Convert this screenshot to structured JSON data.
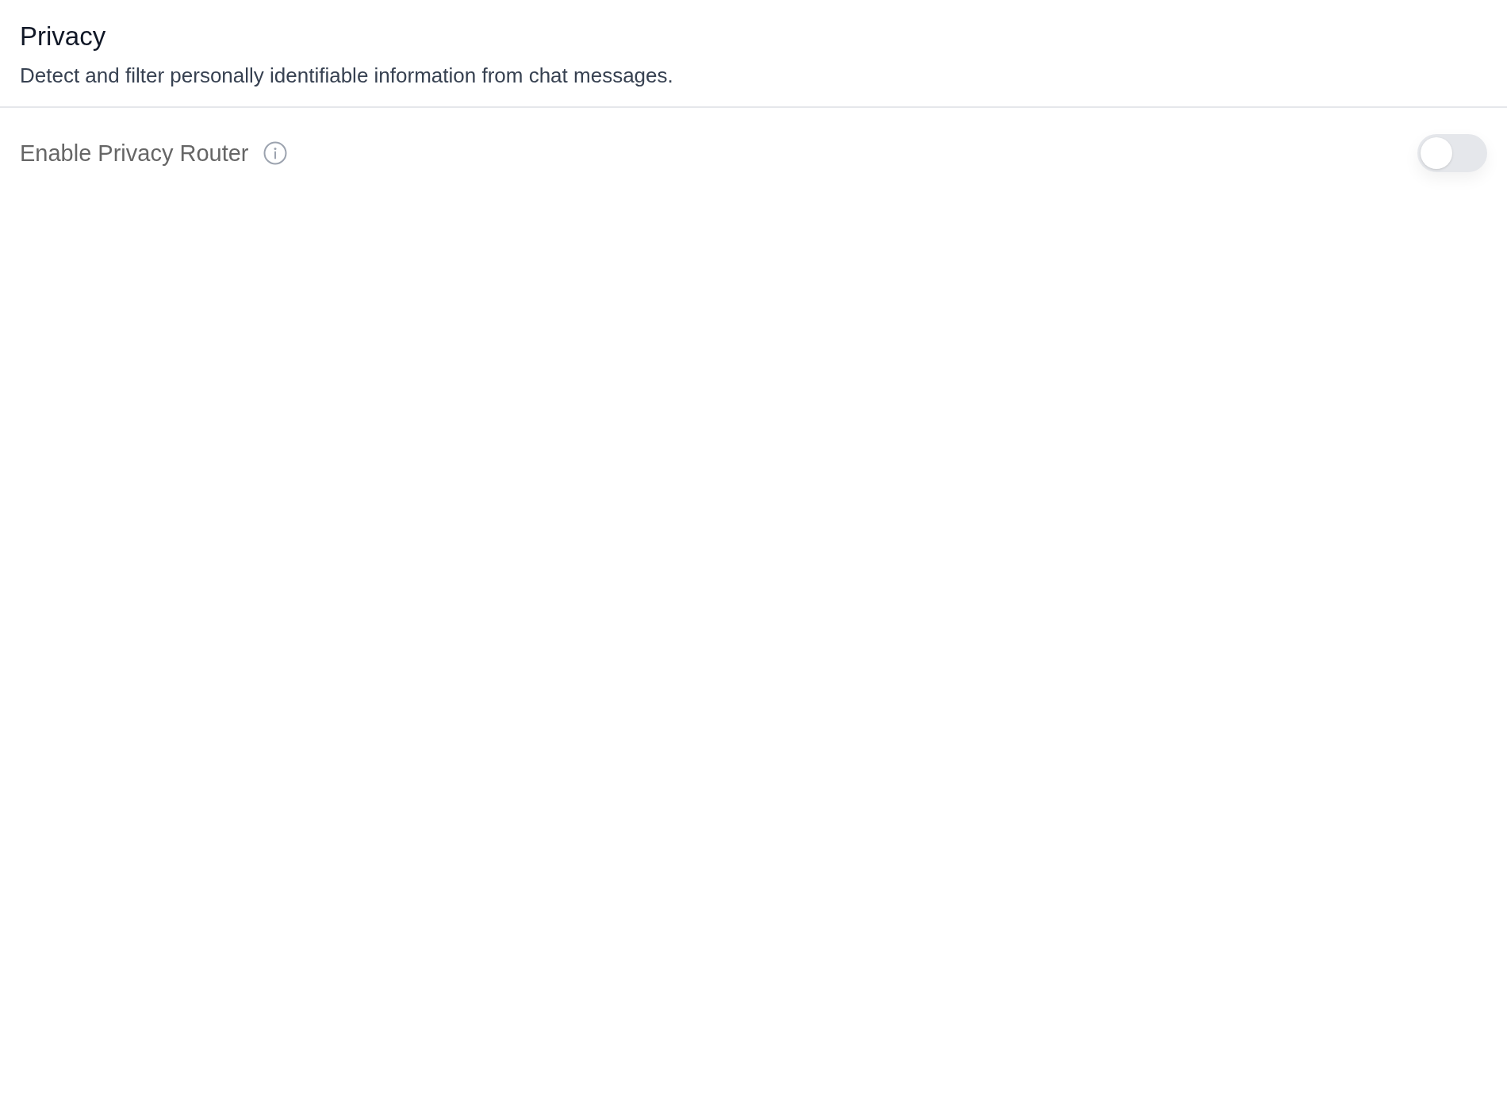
{
  "header": {
    "title": "Privacy",
    "description": "Detect and filter personally identifiable information from chat messages."
  },
  "settings": [
    {
      "kind": "toggle",
      "label": "Enable Privacy Router",
      "info": true,
      "on": false
    }
  ]
}
